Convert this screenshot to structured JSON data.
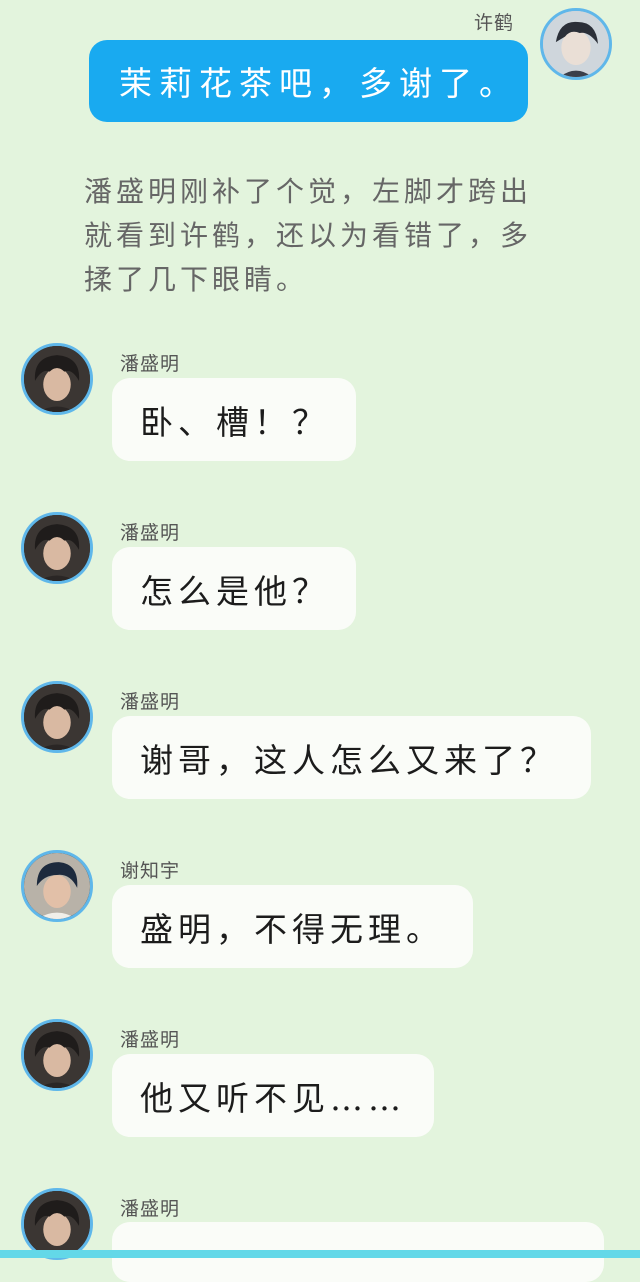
{
  "messages": [
    {
      "sender": "许鹤",
      "text": "茉莉花茶吧，多谢了。",
      "avatar_icon": "xuhe-avatar-icon"
    },
    {
      "sender": "潘盛明",
      "text": "卧、槽！？",
      "avatar_icon": "panshengming-avatar-icon"
    },
    {
      "sender": "潘盛明",
      "text": "怎么是他？",
      "avatar_icon": "panshengming-avatar-icon"
    },
    {
      "sender": "潘盛明",
      "text": "谢哥，这人怎么又来了？",
      "avatar_icon": "panshengming-avatar-icon"
    },
    {
      "sender": "谢知宇",
      "text": "盛明，不得无理。",
      "avatar_icon": "xiezhiyu-avatar-icon"
    },
    {
      "sender": "潘盛明",
      "text": "他又听不见……",
      "avatar_icon": "panshengming-avatar-icon"
    },
    {
      "sender": "潘盛明",
      "text": "",
      "avatar_icon": "panshengming-avatar-icon"
    }
  ],
  "narration": "潘盛明刚补了个觉，左脚才跨出就看到许鹤，还以为看错了，多揉了几下眼睛。",
  "colors": {
    "background": "#e3f4dd",
    "self_bubble": "#19aaf0",
    "other_bubble": "#fafcf8",
    "avatar_ring": "#5fb7ea"
  }
}
